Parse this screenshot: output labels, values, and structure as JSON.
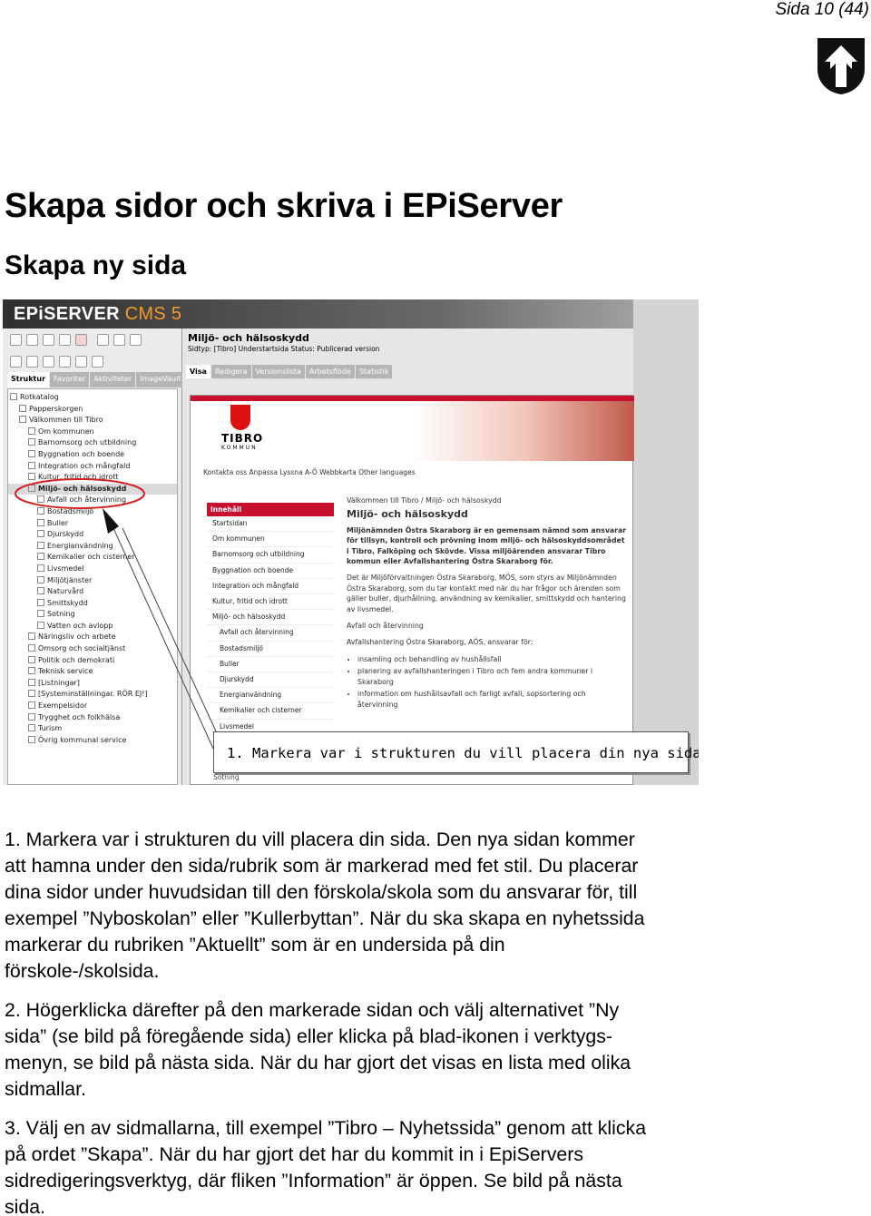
{
  "header": {
    "page_number": "Sida 10 (44)",
    "logo_icon": "municipality-crest-icon"
  },
  "title": "Skapa sidor och skriva i EPiServer",
  "subtitle": "Skapa ny sida",
  "screenshot": {
    "app_logo": "EPiSERVER",
    "app_logo_suffix": "CMS 5",
    "left_tabs": [
      "Struktur",
      "Favoriter",
      "Aktiviteter",
      "ImageVault"
    ],
    "tree_items": [
      "Rotkatalog",
      "Papperskorgen",
      "Välkommen till Tibro",
      "Om kommunen",
      "Barnomsorg och utbildning",
      "Byggnation och boende",
      "Integration och mångfald",
      "Kultur, fritid och idrott",
      "Miljö- och hälsoskydd",
      "Avfall och återvinning",
      "Bostadsmiljö",
      "Buller",
      "Djurskydd",
      "Energianvändning",
      "Kemikalier och cisterner",
      "Livsmedel",
      "Miljötjänster",
      "Naturvård",
      "Smittskydd",
      "Sotning",
      "Vatten och avlopp",
      "Näringsliv och arbete",
      "Omsorg och socialtjänst",
      "Politik och demokrati",
      "Teknisk service",
      "[Listningar]",
      "[Systeminställningar. RÖR EJ!]",
      "Exempelsidor",
      "Trygghet och folkhälsa",
      "Turism",
      "Övrig kommunal service"
    ],
    "page_title": "Miljö- och hälsoskydd",
    "page_meta": "Sidtyp: [Tibro] Understartsida   Status: Publicerad version",
    "right_tabs": [
      "Visa",
      "Redigera",
      "Versionslista",
      "Arbetsflöde",
      "Statistik"
    ],
    "site_name": "TIBRO",
    "site_name_sub": "KOMMUN",
    "site_nav": "Kontakta oss    Anpassa    Lyssna    A-Ö    Webbkarta    Other languages",
    "leftnav_header": "Innehåll",
    "leftnav_items": [
      "Startsidan",
      "Om kommunen",
      "Barnomsorg och utbildning",
      "Byggnation och boende",
      "Integration och mångfald",
      "Kultur, fritid och idrott",
      "Miljö- och hälsoskydd",
      "Avfall och återvinning",
      "Bostadsmiljö",
      "Buller",
      "Djurskydd",
      "Energianvändning",
      "Kemikalier och cisterner",
      "Livsmedel"
    ],
    "breadcrumb": "Välkommen till Tibro  /  Miljö- och hälsoskydd",
    "content_title": "Miljö- och hälsoskydd",
    "content_intro": "Miljönämnden Östra Skaraborg är en gemensam nämnd som ansvarar för tillsyn, kontroll och prövning inom miljö- och hälsoskyddsområdet i Tibro, Falköping och Skövde. Vissa miljöärenden ansvarar Tibro kommun eller Avfallshantering Östra Skaraborg för.",
    "content_body": "Det är Miljöförvaltningen Östra Skaraborg, MÖS, som styrs av Miljönämnden Östra Skaraborg, som du tar kontakt med när du har frågor och ärenden som gäller buller, djurhållning, användning av kemikalier, smittskydd och hantering av livsmedel.",
    "content_link": "Avfall och återvinning",
    "content_aos": "Avfallshantering Östra Skaraborg, AÖS, ansvarar för:",
    "content_list": [
      "insamling och behandling av hushållsfall",
      "planering av avfallshanteringen i Tibro och fem andra kommuner i Skaraborg",
      "information om hushållsavfall och farligt avfall, sopsortering och återvinning"
    ],
    "callout": "1. Markera var i strukturen du vill placera din nya sida.",
    "footer_item": "Sotning"
  },
  "paragraphs": [
    "1. Markera var i strukturen du vill placera din sida. Den nya sidan kommer att hamna under den sida/rubrik som är markerad med fet stil. Du placerar dina sidor under huvudsidan till den förskola/skola som du ansvarar för, till exempel ”Nyboskolan” eller ”Kullerbyttan”. När du ska skapa en nyhetssida markerar du rubriken ”Aktuellt” som är en undersida på din förskole-/skolsida.",
    "2. Högerklicka därefter på den markerade sidan och välj alternativet ”Ny sida” (se bild på föregående sida) eller klicka på blad-ikonen i verktygs-menyn, se bild på nästa sida. När du har gjort det visas en lista med olika sidmallar.",
    "3. Välj en av sidmallarna, till exempel ”Tibro – Nyhetssida” genom att klicka på ordet ”Skapa”. När du har gjort det har du kommit in i EpiServers sidredigeringsverktyg, där fliken ”Information” är öppen. Se bild på nästa sida."
  ]
}
